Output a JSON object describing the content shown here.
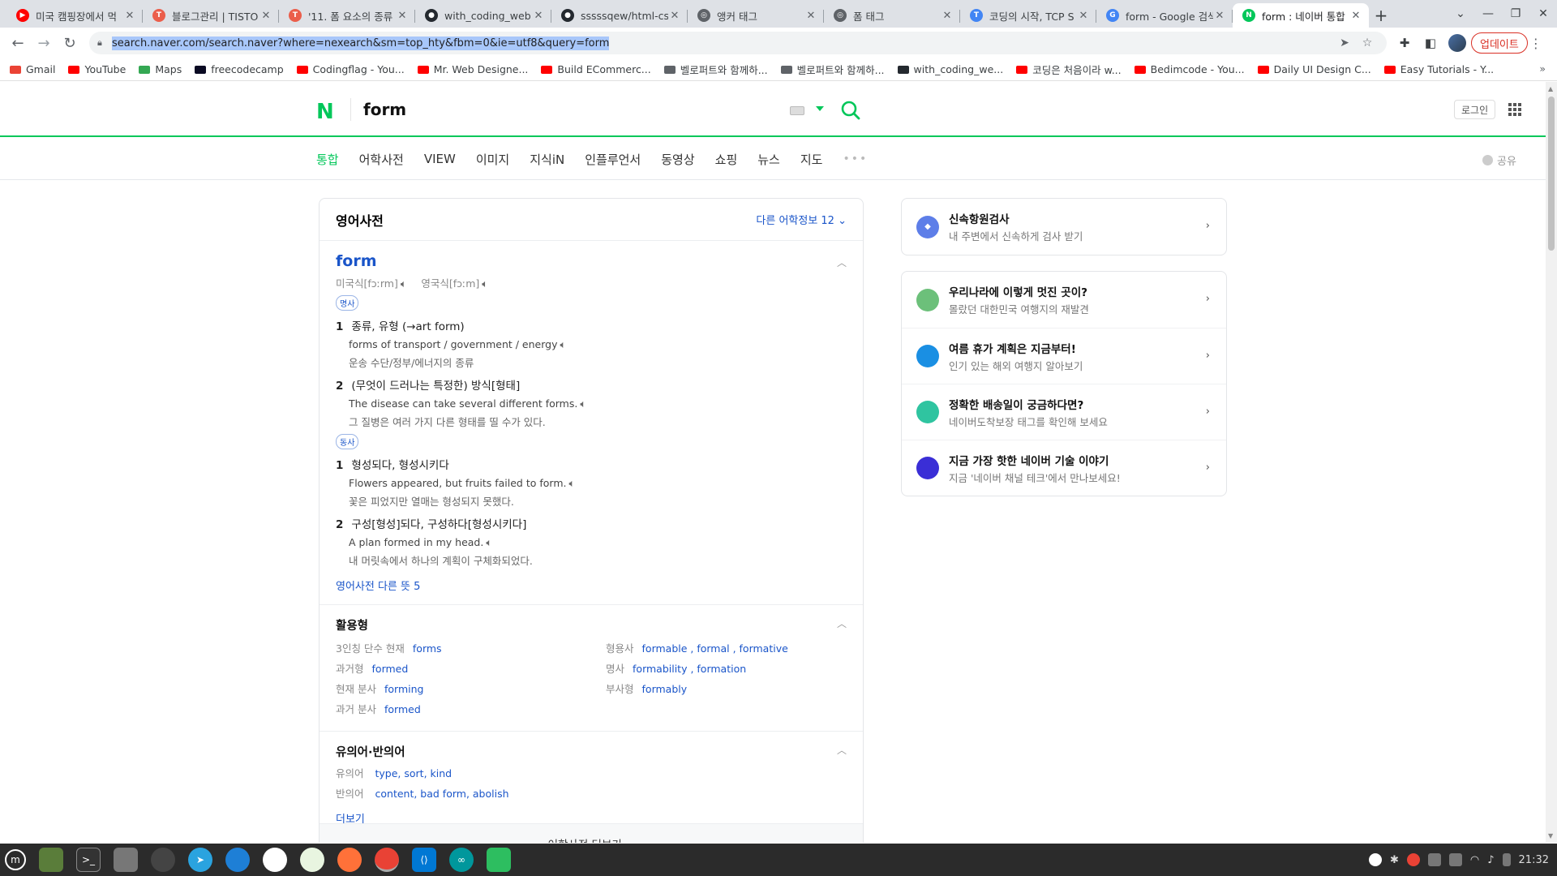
{
  "browser": {
    "tabs": [
      {
        "title": "미국 캠핑장에서 먹",
        "fav_color": "#ff0000",
        "fav_glyph": "▶"
      },
      {
        "title": "블로그관리 | TISTO",
        "fav_color": "#eb5e4b",
        "fav_glyph": "T"
      },
      {
        "title": "'11. 폼 요소의 종류",
        "fav_color": "#eb5e4b",
        "fav_glyph": "T"
      },
      {
        "title": "with_coding_web",
        "fav_color": "#24292f",
        "fav_glyph": "●"
      },
      {
        "title": "sssssqew/html-cs",
        "fav_color": "#24292f",
        "fav_glyph": "●"
      },
      {
        "title": "앵커 태그",
        "fav_color": "#5f6368",
        "fav_glyph": "◎"
      },
      {
        "title": "폼 태그",
        "fav_color": "#5f6368",
        "fav_glyph": "◎"
      },
      {
        "title": "코딩의 시작, TCP S",
        "fav_color": "#4285f4",
        "fav_glyph": "T"
      },
      {
        "title": "form - Google 검색",
        "fav_color": "#4285f4",
        "fav_glyph": "G"
      },
      {
        "title": "form : 네이버 통합",
        "fav_color": "#03c75a",
        "fav_glyph": "N"
      }
    ],
    "active_tab": 9,
    "url": "search.naver.com/search.naver?where=nexearch&sm=top_hty&fbm=0&ie=utf8&query=form",
    "update_label": "업데이트",
    "bookmarks": [
      {
        "label": "Gmail",
        "color": "#ea4335"
      },
      {
        "label": "YouTube",
        "color": "#ff0000"
      },
      {
        "label": "Maps",
        "color": "#34a853"
      },
      {
        "label": "freecodecamp",
        "color": "#0a0a23"
      },
      {
        "label": "Codingflag - You...",
        "color": "#ff0000"
      },
      {
        "label": "Mr. Web Designe...",
        "color": "#ff0000"
      },
      {
        "label": "Build ECommerc...",
        "color": "#ff0000"
      },
      {
        "label": "벨로퍼트와 함께하...",
        "color": "#5f6368"
      },
      {
        "label": "벨로퍼트와 함께하...",
        "color": "#5f6368"
      },
      {
        "label": "with_coding_we...",
        "color": "#24292f"
      },
      {
        "label": "코딩은 처음이라 w...",
        "color": "#ff0000"
      },
      {
        "label": "Bedimcode - You...",
        "color": "#ff0000"
      },
      {
        "label": "Daily UI Design C...",
        "color": "#ff0000"
      },
      {
        "label": "Easy Tutorials - Y...",
        "color": "#ff0000"
      }
    ]
  },
  "naver": {
    "logo": "N",
    "query": "form",
    "login_label": "로그인",
    "tabs": [
      "통합",
      "어학사전",
      "VIEW",
      "이미지",
      "지식iN",
      "인플루언서",
      "동영상",
      "쇼핑",
      "뉴스",
      "지도"
    ],
    "more_tabs": "•••",
    "share_label": "공유",
    "dict": {
      "title": "영어사전",
      "more_info": "다른 어학정보 12",
      "word": "form",
      "pron_us": "미국식[fɔːrm]",
      "pron_uk": "영국식[fɔːm]",
      "pos_noun": "명사",
      "pos_verb": "동사",
      "noun_senses": [
        {
          "num": "1",
          "def": "종류, 유형 (→art form)",
          "en": "forms of transport / government / energy",
          "ko": "운송 수단/정부/에너지의 종류"
        },
        {
          "num": "2",
          "def": "(무엇이 드러나는 특정한) 방식[형태]",
          "en": "The disease can take several different forms.",
          "ko": "그 질병은 여러 가지 다른 형태를 띨 수가 있다."
        }
      ],
      "verb_senses": [
        {
          "num": "1",
          "def": "형성되다, 형성시키다",
          "en": "Flowers appeared, but fruits failed to form.",
          "ko": "꽃은 피었지만 열매는 형성되지 못했다."
        },
        {
          "num": "2",
          "def": "구성[형성]되다, 구성하다[형성시키다]",
          "en": "A plan formed in my head.",
          "ko": "내 머릿속에서 하나의 계획이 구체화되었다."
        }
      ],
      "more_senses": "영어사전 다른 뜻 5",
      "forms_title": "활용형",
      "forms_left": [
        {
          "label": "3인칭 단수 현재",
          "value": "forms"
        },
        {
          "label": "과거형",
          "value": "formed"
        },
        {
          "label": "현재 분사",
          "value": "forming"
        },
        {
          "label": "과거 분사",
          "value": "formed"
        }
      ],
      "forms_right": [
        {
          "label": "형용사",
          "value": "formable , formal , formative"
        },
        {
          "label": "명사",
          "value": "formability , formation"
        },
        {
          "label": "부사형",
          "value": "formably"
        }
      ],
      "syn_title": "유의어·반의어",
      "syn_label": "유의어",
      "syn_value": "type, sort, kind",
      "ant_label": "반의어",
      "ant_value": "content, bad form, abolish",
      "more_link": "더보기",
      "footer": "어학사전 더보기 →"
    },
    "side_top": {
      "title": "신속항원검사",
      "desc": "내 주변에서 신속하게 검사 받기",
      "color": "#5d7ee8"
    },
    "side_list": [
      {
        "title": "우리나라에 이렇게 멋진 곳이?",
        "desc": "몰랐던 대한민국 여행지의 재발견",
        "color": "#6cc07a"
      },
      {
        "title": "여름 휴가 계획은 지금부터!",
        "desc": "인기 있는 해외 여행지 알아보기",
        "color": "#1a8fe3"
      },
      {
        "title": "정확한 배송일이 궁금하다면?",
        "desc": "네이버도착보장 태그를 확인해 보세요",
        "color": "#2fc4a0"
      },
      {
        "title": "지금 가장 핫한 네이버 기술 이야기",
        "desc": "지금 '네이버 채널 테크'에서 만나보세요!",
        "color": "#3a2ed6"
      }
    ]
  },
  "taskbar": {
    "clock": "21:32"
  }
}
